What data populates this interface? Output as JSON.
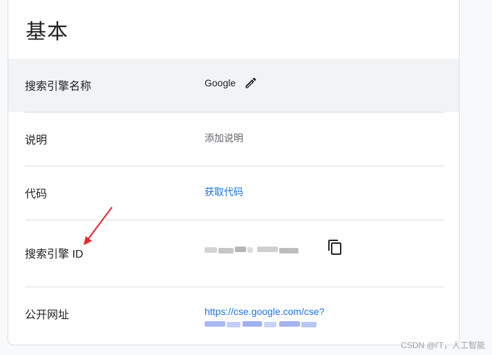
{
  "card": {
    "title": "基本"
  },
  "rows": [
    {
      "label": "搜索引擎名称",
      "value": "Google",
      "edit_icon": "pencil-icon"
    },
    {
      "label": "说明",
      "value": "添加说明"
    },
    {
      "label": "代码",
      "value": "获取代码"
    },
    {
      "label": "搜索引擎 ID",
      "value_hidden": true,
      "copy_icon": "copy-icon"
    },
    {
      "label": "公开网址",
      "value": "https://cse.google.com/cse?"
    }
  ],
  "colors": {
    "link": "#1a73e8",
    "highlight_row": "#f1f3f4",
    "annotation_arrow": "#e8232a",
    "divider": "#dadce0"
  },
  "watermark": "CSDN @l'T，人工智能"
}
